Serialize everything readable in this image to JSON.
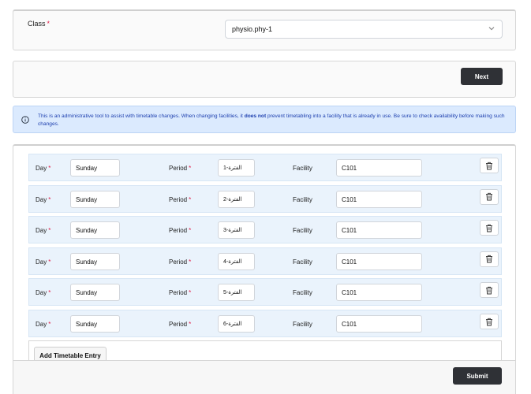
{
  "class_field": {
    "label": "Class",
    "required_mark": "*",
    "selected_value": "physio.phy-1"
  },
  "next_button": {
    "label": "Next"
  },
  "info_banner": {
    "text_before": "This is an administrative tool to assist with timetable changes. When changing facilities, it ",
    "text_bold": "does not",
    "text_after": " prevent timetabling into a facility that is already in use. Be sure to check availability before making such changes."
  },
  "entry_labels": {
    "day": "Day",
    "period": "Period",
    "facility": "Facility",
    "required_mark": "*"
  },
  "entries": [
    {
      "day": "Sunday",
      "period": "الفترة-1",
      "facility": "C101"
    },
    {
      "day": "Sunday",
      "period": "الفترة-2",
      "facility": "C101"
    },
    {
      "day": "Sunday",
      "period": "الفترة-3",
      "facility": "C101"
    },
    {
      "day": "Sunday",
      "period": "الفترة-4",
      "facility": "C101"
    },
    {
      "day": "Sunday",
      "period": "الفترة-5",
      "facility": "C101"
    },
    {
      "day": "Sunday",
      "period": "الفترة-6",
      "facility": "C101"
    }
  ],
  "add_button": {
    "label": "Add Timetable Entry"
  },
  "submit_button": {
    "label": "Submit"
  },
  "icons": {
    "select": "chevron-down-icon",
    "info": "info-icon",
    "delete": "trash-icon"
  },
  "colors": {
    "primary_button": "#2f3136",
    "info_bg": "#dbeafe",
    "info_text": "#1e40af",
    "row_bg": "#eaf3fc",
    "required": "#e11d48"
  }
}
